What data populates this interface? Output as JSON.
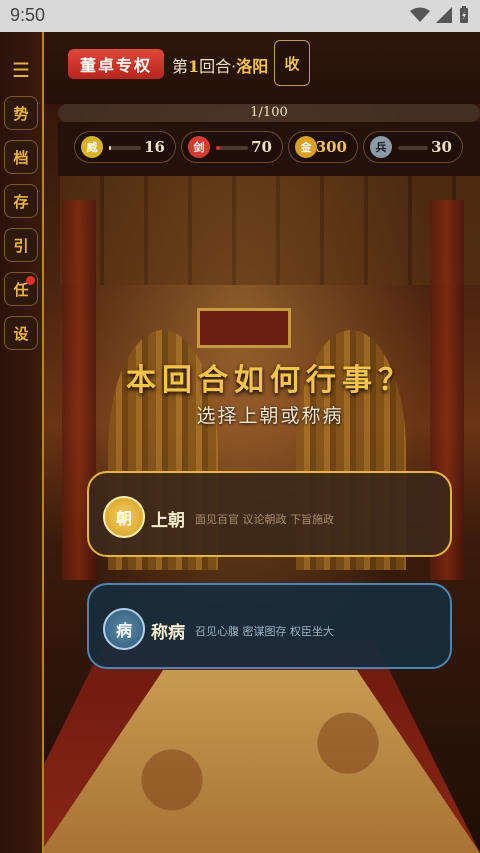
{
  "status_bar": {
    "time": "9:50"
  },
  "sidebar": {
    "menu_icon": "hamburger-icon",
    "items": [
      {
        "label": "势"
      },
      {
        "label": "档"
      },
      {
        "label": "存"
      },
      {
        "label": "引"
      },
      {
        "label": "任",
        "has_notification": true
      },
      {
        "label": "设"
      }
    ]
  },
  "header": {
    "title": "董卓专权",
    "round_prefix": "第",
    "round_number": "1",
    "round_suffix": "回合·",
    "city": "洛阳",
    "collect_label": "收"
  },
  "progress": {
    "label": "1/100",
    "current": 1,
    "total": 100
  },
  "stats": [
    {
      "icon_label": "威",
      "value": "16",
      "fill": 0.06,
      "color": "#d9b22a"
    },
    {
      "icon_label": "剑",
      "value": "70",
      "fill": 0.08,
      "color": "#d63a30"
    },
    {
      "icon_label": "金",
      "value": "300",
      "color": "#d9a020"
    },
    {
      "icon_label": "兵",
      "value": "30",
      "fill": 0.0,
      "color": "#8a9aa6"
    }
  ],
  "prompt": {
    "question": "本回合如何行事？",
    "subtitle": "选择上朝或称病"
  },
  "choices": [
    {
      "icon_label": "朝",
      "title": "上朝",
      "description": "面见百官 议论朝政 下旨施政"
    },
    {
      "icon_label": "病",
      "title": "称病",
      "description": "召见心腹 密谋图存 权臣坐大"
    }
  ]
}
